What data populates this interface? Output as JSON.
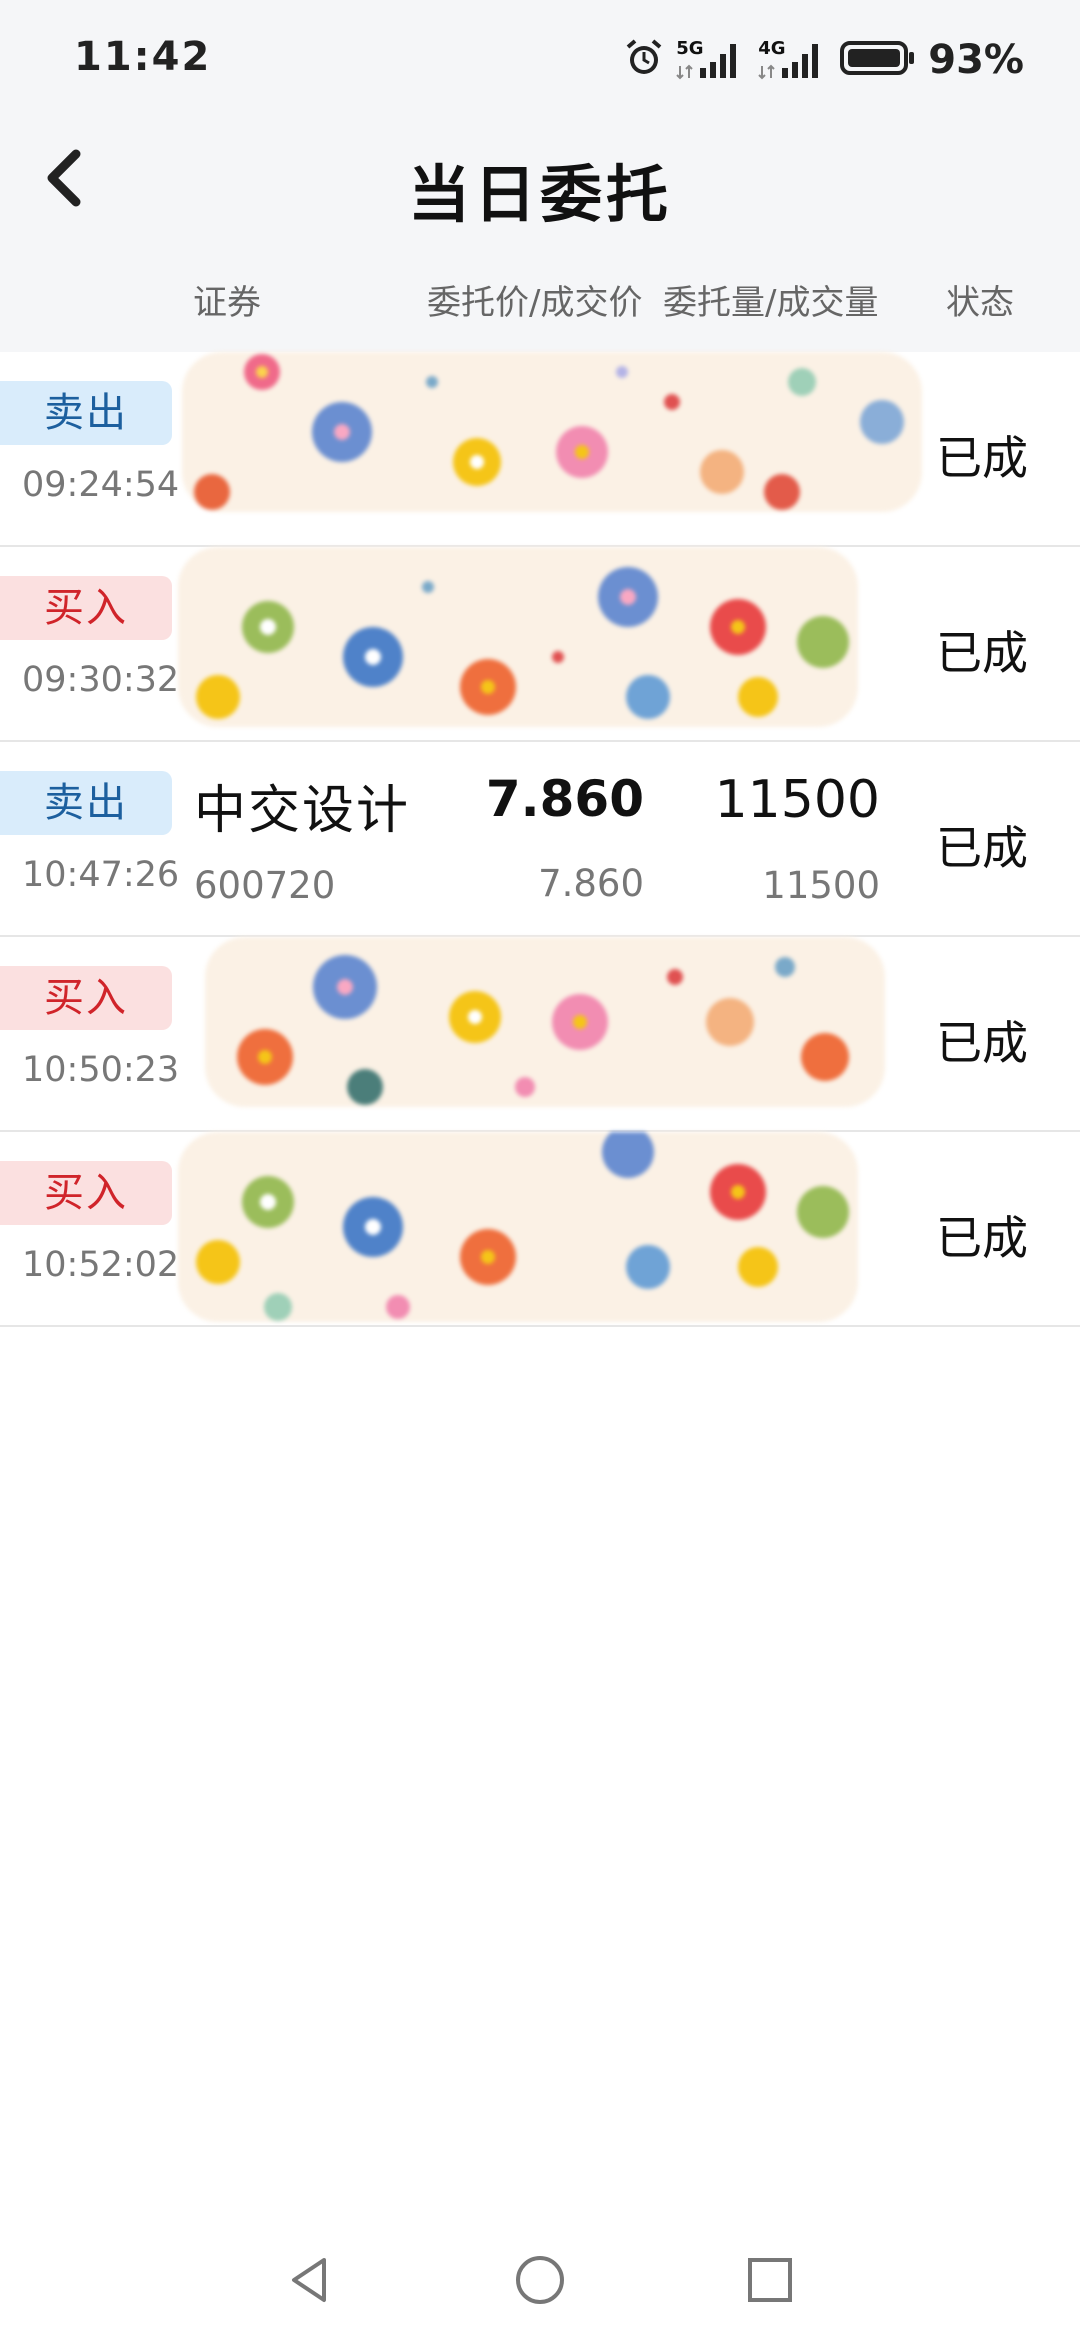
{
  "status_bar": {
    "time": "11:42",
    "net1": "5G",
    "net2": "4G",
    "battery": "93%"
  },
  "header": {
    "title": "当日委托"
  },
  "columns": {
    "security": "证券",
    "price": "委托价/成交价",
    "qty": "委托量/成交量",
    "state": "状态"
  },
  "orders": [
    {
      "side": "卖出",
      "side_type": "sell",
      "time": "09:24:54",
      "name": "",
      "code": "",
      "price": "",
      "deal_price": "",
      "qty": "",
      "deal_qty": "",
      "state": "已成",
      "masked": true
    },
    {
      "side": "买入",
      "side_type": "buy",
      "time": "09:30:32",
      "name": "",
      "code": "",
      "price": "",
      "deal_price": "",
      "qty": "",
      "deal_qty": "",
      "state": "已成",
      "masked": true
    },
    {
      "side": "卖出",
      "side_type": "sell",
      "time": "10:47:26",
      "name": "中交设计",
      "code": "600720",
      "price": "7.860",
      "deal_price": "7.860",
      "qty": "11500",
      "deal_qty": "11500",
      "state": "已成",
      "masked": false
    },
    {
      "side": "买入",
      "side_type": "buy",
      "time": "10:50:23",
      "name": "",
      "code": "",
      "price": "",
      "deal_price": "",
      "qty": "",
      "deal_qty": "",
      "state": "已成",
      "masked": true
    },
    {
      "side": "买入",
      "side_type": "buy",
      "time": "10:52:02",
      "name": "",
      "code": "",
      "price": "",
      "deal_price": "",
      "qty": "",
      "deal_qty": "",
      "state": "已成",
      "masked": true
    }
  ],
  "colors": {
    "sell_bg": "#d9ecfb",
    "sell_text": "#1c5f9e",
    "buy_bg": "#fbe0e0",
    "buy_text": "#d0242a"
  },
  "icons": {
    "back": "chevron-left-icon",
    "alarm": "alarm-icon",
    "signal": "signal-icon",
    "battery": "battery-icon",
    "nav_back": "triangle-back-icon",
    "nav_home": "circle-home-icon",
    "nav_recent": "square-recent-icon"
  }
}
